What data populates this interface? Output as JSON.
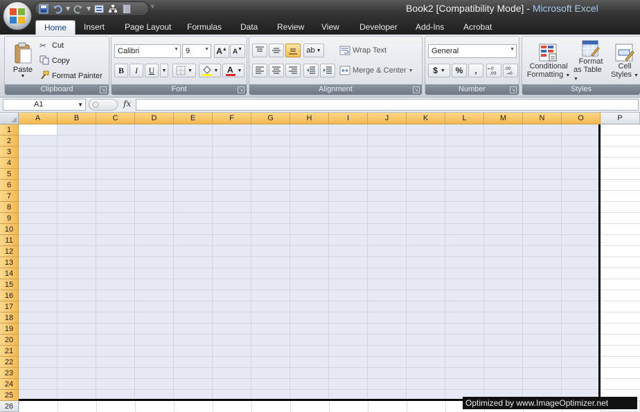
{
  "window": {
    "doc_title": "Book2  [Compatibility Mode]",
    "separator": " - ",
    "app_name": "Microsoft Excel"
  },
  "quick_access": {
    "icons": [
      "save-icon",
      "undo-icon",
      "redo-icon",
      "form-icon",
      "diagram-icon",
      "table-icon"
    ],
    "more": "▿"
  },
  "tabs": [
    "Home",
    "Insert",
    "Page Layout",
    "Formulas",
    "Data",
    "Review",
    "View",
    "Developer",
    "Add-Ins",
    "Acrobat"
  ],
  "active_tab": "Home",
  "ribbon": {
    "clipboard": {
      "label": "Clipboard",
      "paste": "Paste",
      "cut": "Cut",
      "copy": "Copy",
      "format_painter": "Format Painter"
    },
    "font": {
      "label": "Font",
      "font_name": "Calibri",
      "font_size": "9",
      "bold": "B",
      "italic": "I",
      "underline": "U"
    },
    "alignment": {
      "label": "Alignment",
      "wrap_text": "Wrap Text",
      "merge_center": "Merge & Center"
    },
    "number": {
      "label": "Number",
      "format": "General",
      "currency": "$",
      "percent": "%",
      "comma": ","
    },
    "styles": {
      "label": "Styles",
      "conditional_1": "Conditional",
      "conditional_2": "Formatting",
      "format_table_1": "Format",
      "format_table_2": "as Table",
      "cell_styles_1": "Cell",
      "cell_styles_2": "Styles"
    }
  },
  "formula_bar": {
    "name_box": "A1",
    "fx": "fx",
    "formula": ""
  },
  "sheet": {
    "columns": [
      "A",
      "B",
      "C",
      "D",
      "E",
      "F",
      "G",
      "H",
      "I",
      "J",
      "K",
      "L",
      "M",
      "N",
      "O",
      "P"
    ],
    "selected_columns": [
      "A",
      "B",
      "C",
      "D",
      "E",
      "F",
      "G",
      "H",
      "I",
      "J",
      "K",
      "L",
      "M",
      "N",
      "O"
    ],
    "rows": [
      "1",
      "2",
      "3",
      "4",
      "5",
      "6",
      "7",
      "8",
      "9",
      "10",
      "11",
      "12",
      "13",
      "14",
      "15",
      "16",
      "17",
      "18",
      "19",
      "20",
      "21",
      "22",
      "23",
      "24",
      "25",
      "26"
    ],
    "selected_rows_count": 25,
    "selection_color": "#e6e9f3",
    "header_highlight_color": "#f5b84f"
  },
  "watermark": "Optimized by www.ImageOptimizer.net"
}
